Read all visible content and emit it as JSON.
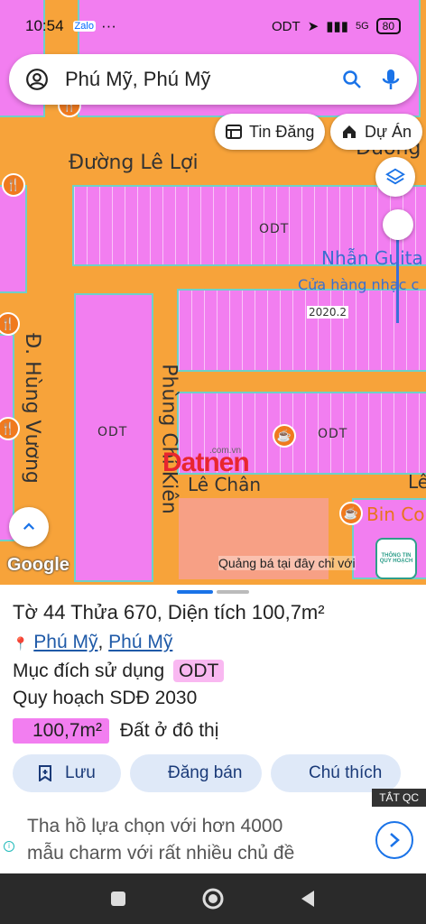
{
  "status": {
    "time": "10:54",
    "apps": "Zalo",
    "dots": "···",
    "carrier": "ODT",
    "network": "5G",
    "battery": "80"
  },
  "search": {
    "query": "Phú Mỹ, Phú Mỹ"
  },
  "chips": {
    "listings": "Tin Đăng",
    "projects": "Dự Án"
  },
  "map": {
    "streets": {
      "le_loi": "Đường Lê Lợi",
      "hung_vuong": "Đ. Hùng Vương",
      "phung_chi_kien": "Phùng Chí Kiên",
      "le_chan": "Lê Chân",
      "duong_l": "Đường L",
      "le": "Lê"
    },
    "zones": [
      "ODT",
      "ODT",
      "ODT"
    ],
    "poi_guitar": "Nhẫn Guita",
    "poi_music": "Cửa hàng nhạc c",
    "poi_bin": "Bin Co",
    "parcel_label": "2020.2",
    "watermark": "Datnen",
    "watermark_url": ".com.vn",
    "google": "Google",
    "promo": "Quảng bá tại đây chỉ với",
    "info_badge": "THÔNG TIN QUY HOẠCH"
  },
  "parcel": {
    "sheet_label": "Tờ",
    "sheet": "44",
    "lot_label": "Thửa",
    "lot": "670",
    "area_label": "Diện tích",
    "area": "100,7m²",
    "ward": "Phú Mỹ",
    "district": "Phú Mỹ",
    "purpose_label": "Mục đích sử dụng",
    "purpose": "ODT",
    "plan": "Quy hoạch SDĐ 2030",
    "area_badge": "100,7m²",
    "land_type": "Đất ở đô thị"
  },
  "actions": {
    "save": "Lưu",
    "post": "Đăng bán",
    "legend": "Chú thích"
  },
  "ad": {
    "tag": "TẮT QC",
    "line1": "Tha hồ lựa chọn với hơn 4000",
    "line2": "mẫu charm với rất nhiều chủ đề"
  },
  "colors": {
    "road": "#f7a33a",
    "residential": "#f27ef0",
    "accent": "#1a73e8"
  }
}
